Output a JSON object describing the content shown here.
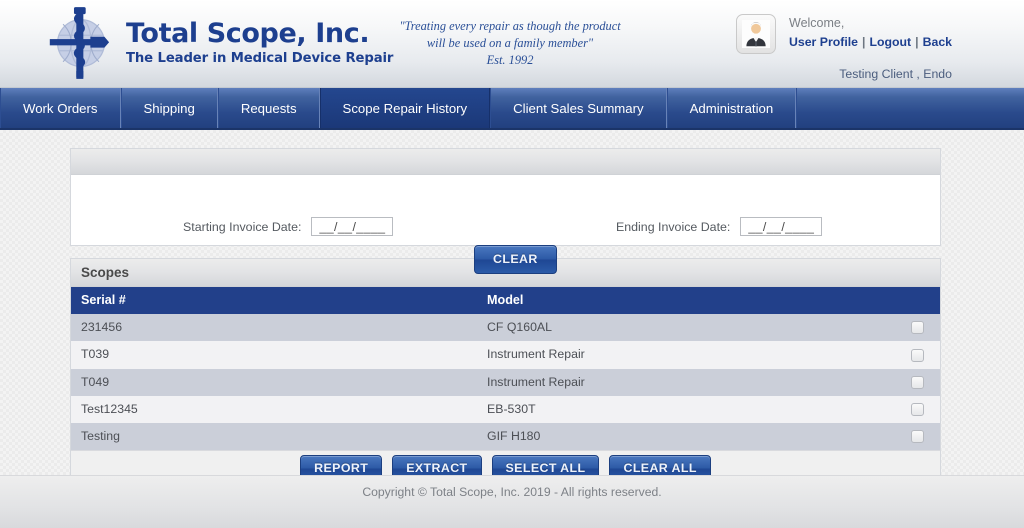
{
  "brand": {
    "name": "Total Scope, Inc.",
    "tagline": "The Leader in Medical Device Repair",
    "logo_icon": "scope-caduceus-globe-logo",
    "accent_color": "#1d3f8f"
  },
  "motto": {
    "line1": "\"Treating every repair as though the product",
    "line2": "will be used on a family member\"",
    "line3": "Est. 1992"
  },
  "user": {
    "avatar_icon": "user-avatar-icon",
    "welcome": "Welcome,",
    "profile_label": "User Profile",
    "logout_label": "Logout",
    "back_label": "Back",
    "separator": "|",
    "client_line": "Testing Client , Endo"
  },
  "nav": {
    "items": [
      {
        "label": "Work Orders",
        "active": false
      },
      {
        "label": "Shipping",
        "active": false
      },
      {
        "label": "Requests",
        "active": false
      },
      {
        "label": "Scope Repair History",
        "active": true
      },
      {
        "label": "Client Sales Summary",
        "active": false
      },
      {
        "label": "Administration",
        "active": false
      }
    ]
  },
  "filter": {
    "panel_title": "",
    "starting_label": "Starting Invoice Date:",
    "starting_value": "__/__/____",
    "starting_placeholder": "__/__/____",
    "ending_label": "Ending Invoice Date:",
    "ending_value": "__/__/____",
    "ending_placeholder": "__/__/____",
    "clear_label": "CLEAR"
  },
  "scopes": {
    "panel_title": "Scopes",
    "columns": [
      "Serial #",
      "Model",
      ""
    ],
    "rows": [
      {
        "serial": "231456",
        "model": "CF Q160AL",
        "checked": false
      },
      {
        "serial": "T039",
        "model": "Instrument Repair",
        "checked": false
      },
      {
        "serial": "T049",
        "model": "Instrument Repair",
        "checked": false
      },
      {
        "serial": "Test12345",
        "model": "EB-530T",
        "checked": false
      },
      {
        "serial": "Testing",
        "model": "GIF H180",
        "checked": false
      }
    ],
    "actions": [
      {
        "label": "REPORT"
      },
      {
        "label": "EXTRACT"
      },
      {
        "label": "SELECT ALL"
      },
      {
        "label": "CLEAR ALL"
      }
    ]
  },
  "footer": {
    "copyright": "Copyright © Total Scope, Inc. 2019 - All rights reserved."
  }
}
